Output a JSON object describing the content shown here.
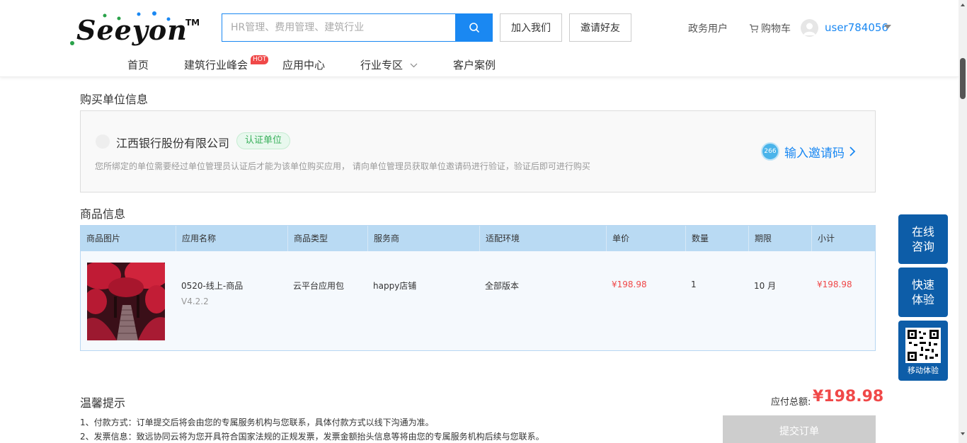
{
  "header": {
    "logo_text": "Seeyon",
    "logo_tm": "TM",
    "search_placeholder": "HR管理、费用管理、建筑行业",
    "join_label": "加入我们",
    "invite_label": "邀请好友",
    "gov_user_label": "政务用户",
    "cart_label": "购物车",
    "username": "user784056"
  },
  "nav": {
    "items": [
      "首页",
      "建筑行业峰会",
      "应用中心",
      "行业专区",
      "客户案例"
    ],
    "hot_badge": "HOT"
  },
  "buyer": {
    "section_title": "购买单位信息",
    "company_name": "江西银行股份有限公司",
    "cert_badge": "认证单位",
    "note": "您所绑定的单位需要经过单位管理员认证后才能为该单位购买应用， 请向单位管理员获取单位邀请码进行验证，验证后即可进行购买",
    "invite_icon_text": "266",
    "invite_code_label": "输入邀请码"
  },
  "products": {
    "section_title": "商品信息",
    "columns": [
      "商品图片",
      "应用名称",
      "商品类型",
      "服务商",
      "适配环境",
      "单价",
      "数量",
      "期限",
      "小计"
    ],
    "row": {
      "name": "0520-线上-商品",
      "version": "V4.2.2",
      "type": "云平台应用包",
      "vendor": "happy店铺",
      "env": "全部版本",
      "unit_price": "¥198.98",
      "quantity": "1",
      "term": "10 月",
      "subtotal": "¥198.98"
    }
  },
  "tips": {
    "title": "温馨提示",
    "lines": [
      "1、付款方式：订单提交后将会由您的专属服务机构与您联系，具体付款方式以线下沟通为准。",
      "2、发票信息：致远协同云将为您开具符合国家法规的正规发票，发票金额抬头信息等将由您的专属服务机构后续与您联系。"
    ]
  },
  "order": {
    "total_label": "应付总额:",
    "total_value": "¥198.98",
    "submit_label": "提交订单"
  },
  "side": {
    "online_consult": "在线咨询",
    "quick_trial": "快速体验",
    "mobile_trial": "移动体验"
  },
  "colors": {
    "primary": "#1a88f2",
    "price_red": "#f04848",
    "side_blue": "#0d5da8",
    "table_head": "#b9daf3"
  }
}
